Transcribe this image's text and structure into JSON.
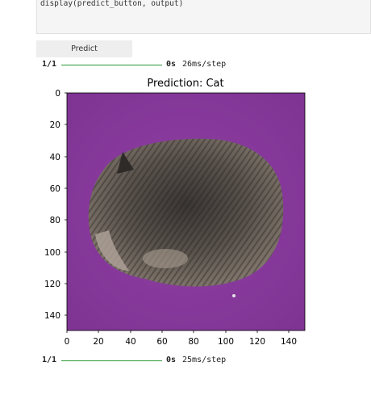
{
  "code_cell": {
    "line": "display(predict_button, output)"
  },
  "predict_button": {
    "label": "Predict"
  },
  "progress_top": {
    "step": "1/1",
    "time": "0s",
    "rate": "26ms/step"
  },
  "plot": {
    "title": "Prediction: Cat",
    "y_ticks": [
      "0",
      "20",
      "40",
      "60",
      "80",
      "100",
      "120",
      "140"
    ],
    "x_ticks": [
      "0",
      "20",
      "40",
      "60",
      "80",
      "100",
      "120",
      "140"
    ],
    "image_subject": "kitten lying on purple blanket"
  },
  "progress_bottom": {
    "step": "1/1",
    "time": "0s",
    "rate": "25ms/step"
  },
  "colors": {
    "progress_bar": "#2e9a3a",
    "blanket": "#8a3a9c"
  }
}
